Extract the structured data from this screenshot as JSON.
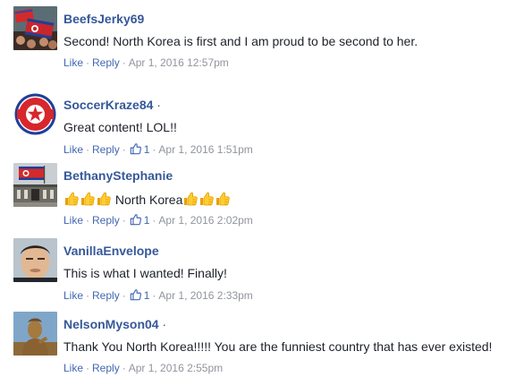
{
  "comments": [
    {
      "author": "BeefsJerky69",
      "name_suffix": "",
      "text": "Second! North Korea is first and I am proud to be second to her.",
      "like_label": "Like",
      "reply_label": "Reply",
      "like_count": "",
      "timestamp": "Apr 1, 2016 12:57pm",
      "avatar_icon": "north-korea-flags-crowd-avatar"
    },
    {
      "author": "SoccerKraze84",
      "name_suffix": "·",
      "text": "Great content! LOL!!",
      "like_label": "Like",
      "reply_label": "Reply",
      "like_count": "1",
      "timestamp": "Apr 1, 2016 1:51pm",
      "avatar_icon": "north-korea-emblem-avatar"
    },
    {
      "author": "BethanyStephanie",
      "name_suffix": "",
      "text_prefix_icons": [
        "thumbs-up-emoji",
        "thumbs-up-emoji",
        "thumbs-up-emoji"
      ],
      "text": "North Korea",
      "text_suffix_icons": [
        "thumbs-up-emoji",
        "thumbs-up-emoji",
        "thumbs-up-emoji"
      ],
      "like_label": "Like",
      "reply_label": "Reply",
      "like_count": "1",
      "timestamp": "Apr 1, 2016 2:02pm",
      "avatar_icon": "flag-over-building-avatar"
    },
    {
      "author": "VanillaEnvelope",
      "name_suffix": "",
      "text": "This is what I wanted! Finally!",
      "like_label": "Like",
      "reply_label": "Reply",
      "like_count": "1",
      "timestamp": "Apr 1, 2016 2:33pm",
      "avatar_icon": "portrait-avatar"
    },
    {
      "author": "NelsonMyson04",
      "name_suffix": "·",
      "text": "Thank You North Korea!!!!! You are the funniest country that has ever existed!",
      "like_label": "Like",
      "reply_label": "Reply",
      "like_count": "",
      "timestamp": "Apr 1, 2016 2:55pm",
      "avatar_icon": "bronze-statue-avatar"
    }
  ],
  "colors": {
    "link": "#4267b2",
    "author": "#365899",
    "meta": "#90949c",
    "text": "#1d2129"
  }
}
